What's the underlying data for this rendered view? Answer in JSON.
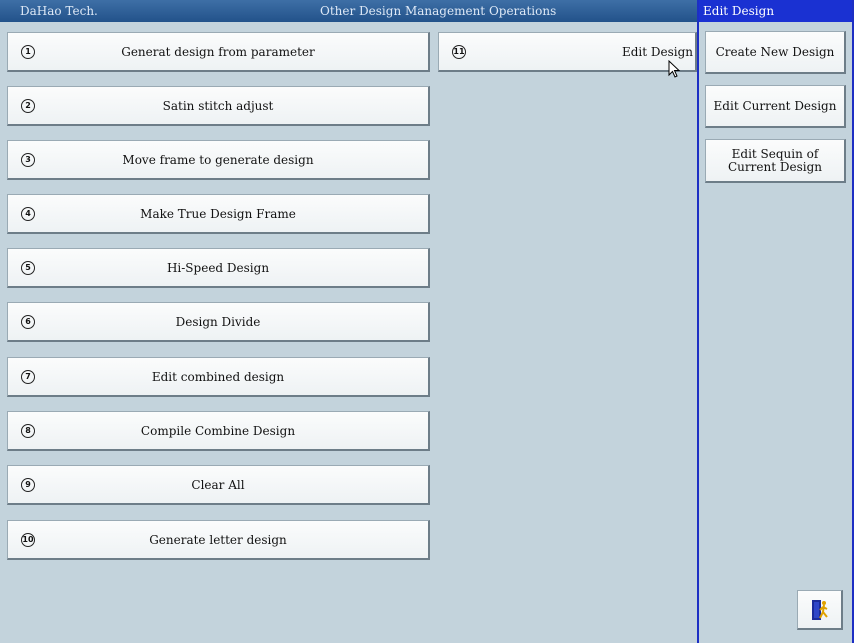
{
  "header": {
    "app_name": "DaHao Tech.",
    "title": "Other Design Management Operations"
  },
  "menu": [
    {
      "num": "1",
      "label": "Generat design from parameter"
    },
    {
      "num": "2",
      "label": "Satin stitch adjust"
    },
    {
      "num": "3",
      "label": "Move frame to generate design"
    },
    {
      "num": "4",
      "label": "Make True Design Frame"
    },
    {
      "num": "5",
      "label": "Hi-Speed Design"
    },
    {
      "num": "6",
      "label": "Design Divide"
    },
    {
      "num": "7",
      "label": "Edit combined design"
    },
    {
      "num": "8",
      "label": "Compile Combine Design"
    },
    {
      "num": "9",
      "label": "Clear All"
    },
    {
      "num": "10",
      "label": "Generate letter design"
    },
    {
      "num": "11",
      "label": "Edit Design"
    }
  ],
  "sidebar": {
    "title": "Edit Design",
    "buttons": [
      {
        "label": "Create New Design"
      },
      {
        "label": "Edit Current Design"
      },
      {
        "label": "Edit Sequin of\nCurrent Design"
      }
    ],
    "exit_icon": "exit-door-icon"
  }
}
